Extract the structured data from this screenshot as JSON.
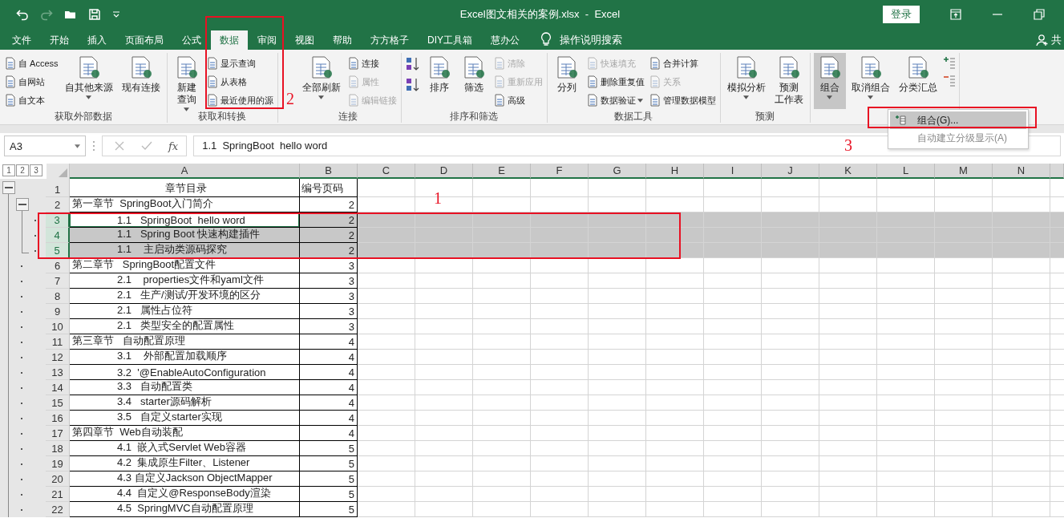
{
  "window": {
    "title": "Excel图文相关的案例.xlsx  -  Excel",
    "sign_in": "登录"
  },
  "tabs": [
    {
      "label": "文件",
      "selected": false
    },
    {
      "label": "开始",
      "selected": false
    },
    {
      "label": "插入",
      "selected": false
    },
    {
      "label": "页面布局",
      "selected": false
    },
    {
      "label": "公式",
      "selected": false
    },
    {
      "label": "数据",
      "selected": true
    },
    {
      "label": "审阅",
      "selected": false
    },
    {
      "label": "视图",
      "selected": false
    },
    {
      "label": "帮助",
      "selected": false
    },
    {
      "label": "方方格子",
      "selected": false
    },
    {
      "label": "DIY工具箱",
      "selected": false
    },
    {
      "label": "慧办公",
      "selected": false
    }
  ],
  "tell_me": {
    "label": "操作说明搜索"
  },
  "share": {
    "label": "共"
  },
  "ribbon": {
    "groups": [
      {
        "label": "获取外部数据",
        "items": [
          {
            "kind": "stack",
            "items": [
              {
                "label": "自 Access",
                "disabled": false,
                "dropdown": false
              },
              {
                "label": "自网站",
                "disabled": false,
                "dropdown": false
              },
              {
                "label": "自文本",
                "disabled": false,
                "dropdown": false
              }
            ]
          },
          {
            "kind": "large",
            "lines": [
              "自其他来源"
            ],
            "dropdown": true,
            "disabled": false,
            "pressed": false
          },
          {
            "kind": "large",
            "lines": [
              "现有连接"
            ],
            "dropdown": false,
            "disabled": false,
            "pressed": false
          }
        ]
      },
      {
        "label": "获取和转换",
        "items": [
          {
            "kind": "large",
            "lines": [
              "新建",
              "查询"
            ],
            "dropdown": true,
            "disabled": false,
            "pressed": false
          },
          {
            "kind": "stack",
            "items": [
              {
                "label": "显示查询",
                "disabled": false,
                "dropdown": false
              },
              {
                "label": "从表格",
                "disabled": false,
                "dropdown": false
              },
              {
                "label": "最近使用的源",
                "disabled": false,
                "dropdown": false
              }
            ]
          }
        ]
      },
      {
        "label": "连接",
        "items": [
          {
            "kind": "large",
            "lines": [
              "全部刷新"
            ],
            "dropdown": true,
            "disabled": false,
            "pressed": false
          },
          {
            "kind": "stack",
            "items": [
              {
                "label": "连接",
                "disabled": false,
                "dropdown": false
              },
              {
                "label": "属性",
                "disabled": true,
                "dropdown": false
              },
              {
                "label": "编辑链接",
                "disabled": true,
                "dropdown": false
              }
            ]
          }
        ]
      },
      {
        "label": "排序和筛选",
        "items": [
          {
            "kind": "sort_buttons"
          },
          {
            "kind": "large",
            "lines": [
              "排序"
            ],
            "dropdown": false,
            "disabled": false,
            "pressed": false
          },
          {
            "kind": "large",
            "lines": [
              "筛选"
            ],
            "dropdown": false,
            "disabled": false,
            "pressed": false
          },
          {
            "kind": "stack",
            "items": [
              {
                "label": "清除",
                "disabled": true,
                "dropdown": false
              },
              {
                "label": "重新应用",
                "disabled": true,
                "dropdown": false
              },
              {
                "label": "高级",
                "disabled": false,
                "dropdown": false
              }
            ]
          }
        ]
      },
      {
        "label": "数据工具",
        "items": [
          {
            "kind": "large",
            "lines": [
              "分列"
            ],
            "dropdown": false,
            "disabled": false,
            "pressed": false
          },
          {
            "kind": "stack",
            "items": [
              {
                "label": "快速填充",
                "disabled": true,
                "dropdown": false
              },
              {
                "label": "删除重复值",
                "disabled": false,
                "dropdown": false
              },
              {
                "label": "数据验证",
                "disabled": false,
                "dropdown": true
              }
            ]
          },
          {
            "kind": "stack",
            "items": [
              {
                "label": "合并计算",
                "disabled": false,
                "dropdown": false
              },
              {
                "label": "关系",
                "disabled": true,
                "dropdown": false
              },
              {
                "label": "管理数据模型",
                "disabled": false,
                "dropdown": false
              }
            ]
          }
        ]
      },
      {
        "label": "预测",
        "items": [
          {
            "kind": "large",
            "lines": [
              "模拟分析"
            ],
            "dropdown": true,
            "disabled": false,
            "pressed": false
          },
          {
            "kind": "large",
            "lines": [
              "预测",
              "工作表"
            ],
            "dropdown": false,
            "disabled": false,
            "pressed": false
          }
        ]
      },
      {
        "items": [
          {
            "kind": "large",
            "lines": [
              "组合"
            ],
            "dropdown": true,
            "disabled": false,
            "pressed": true
          },
          {
            "kind": "large",
            "lines": [
              "取消组合"
            ],
            "dropdown": true,
            "disabled": false,
            "pressed": false
          },
          {
            "kind": "large",
            "lines": [
              "分类汇总"
            ],
            "dropdown": false,
            "disabled": false,
            "pressed": false
          },
          {
            "kind": "detail_buttons"
          }
        ]
      }
    ]
  },
  "formula_bar": {
    "name_box": "A3",
    "function_label": "fx",
    "content": "1.1  SpringBoot  hello word"
  },
  "sheet": {
    "outline_levels": [
      "1",
      "2",
      "3"
    ],
    "columns": [
      "A",
      "B",
      "C",
      "D",
      "E",
      "F",
      "G",
      "H",
      "I",
      "J",
      "K",
      "L",
      "M",
      "N"
    ],
    "rows": [
      {
        "number": "1",
        "kind": "header",
        "a": "章节目录",
        "b": "编号页码",
        "selected": false,
        "active": false,
        "outline": {
          "kind": "top"
        }
      },
      {
        "number": "2",
        "kind": "chapter",
        "a": "第一章节  SpringBoot入门简介",
        "b": "2",
        "selected": false,
        "active": false,
        "outline": {
          "kind": "group"
        }
      },
      {
        "number": "3",
        "kind": "section",
        "a": "1.1   SpringBoot  hello word",
        "b": "2",
        "selected": true,
        "active": true,
        "outline": {
          "kind": "detail3"
        }
      },
      {
        "number": "4",
        "kind": "section",
        "a": "1.1   Spring Boot 快速构建插件",
        "b": "2",
        "selected": true,
        "active": false,
        "outline": {
          "kind": "detail3"
        }
      },
      {
        "number": "5",
        "kind": "section",
        "a": "1.1    主启动类源码探究",
        "b": "2",
        "selected": true,
        "active": false,
        "outline": {
          "kind": "detail3end"
        }
      },
      {
        "number": "6",
        "kind": "chapter",
        "a": "第二章节   SpringBoot配置文件",
        "b": "3",
        "selected": false,
        "active": false,
        "outline": {
          "kind": "detail2"
        }
      },
      {
        "number": "7",
        "kind": "section",
        "a": "2.1    properties文件和yaml文件",
        "b": "3",
        "selected": false,
        "active": false,
        "outline": {
          "kind": "detail2"
        }
      },
      {
        "number": "8",
        "kind": "section",
        "a": "2.1   生产/测试/开发环境的区分",
        "b": "3",
        "selected": false,
        "active": false,
        "outline": {
          "kind": "detail2"
        }
      },
      {
        "number": "9",
        "kind": "section",
        "a": "2.1   属性占位符",
        "b": "3",
        "selected": false,
        "active": false,
        "outline": {
          "kind": "detail2"
        }
      },
      {
        "number": "10",
        "kind": "section",
        "a": "2.1   类型安全的配置属性",
        "b": "3",
        "selected": false,
        "active": false,
        "outline": {
          "kind": "detail2"
        }
      },
      {
        "number": "11",
        "kind": "chapter",
        "a": "第三章节   自动配置原理",
        "b": "4",
        "selected": false,
        "active": false,
        "outline": {
          "kind": "detail2"
        }
      },
      {
        "number": "12",
        "kind": "section",
        "a": "3.1    外部配置加载顺序",
        "b": "4",
        "selected": false,
        "active": false,
        "outline": {
          "kind": "detail2"
        }
      },
      {
        "number": "13",
        "kind": "section",
        "a": "3.2  '@EnableAutoConfiguration",
        "b": "4",
        "selected": false,
        "active": false,
        "outline": {
          "kind": "detail2"
        }
      },
      {
        "number": "14",
        "kind": "section",
        "a": "3.3   自动配置类",
        "b": "4",
        "selected": false,
        "active": false,
        "outline": {
          "kind": "detail2"
        }
      },
      {
        "number": "15",
        "kind": "section",
        "a": "3.4   starter源码解析",
        "b": "4",
        "selected": false,
        "active": false,
        "outline": {
          "kind": "detail2"
        }
      },
      {
        "number": "16",
        "kind": "section",
        "a": "3.5   自定义starter实现",
        "b": "4",
        "selected": false,
        "active": false,
        "outline": {
          "kind": "detail2"
        }
      },
      {
        "number": "17",
        "kind": "chapter",
        "a": "第四章节  Web自动装配",
        "b": "4",
        "selected": false,
        "active": false,
        "outline": {
          "kind": "detail2"
        }
      },
      {
        "number": "18",
        "kind": "section",
        "a": "4.1  嵌入式Servlet Web容器",
        "b": "5",
        "selected": false,
        "active": false,
        "outline": {
          "kind": "detail2"
        }
      },
      {
        "number": "19",
        "kind": "section",
        "a": "4.2  集成原生Filter、Listener",
        "b": "5",
        "selected": false,
        "active": false,
        "outline": {
          "kind": "detail2"
        }
      },
      {
        "number": "20",
        "kind": "section",
        "a": "4.3 自定义Jackson ObjectMapper",
        "b": "5",
        "selected": false,
        "active": false,
        "outline": {
          "kind": "detail2"
        }
      },
      {
        "number": "21",
        "kind": "section",
        "a": "4.4  自定义@ResponseBody渲染",
        "b": "5",
        "selected": false,
        "active": false,
        "outline": {
          "kind": "detail2"
        }
      },
      {
        "number": "22",
        "kind": "section",
        "a": "4.5  SpringMVC自动配置原理",
        "b": "5",
        "selected": false,
        "active": false,
        "outline": {
          "kind": "detail2"
        }
      }
    ]
  },
  "group_menu": {
    "items": [
      {
        "label": "组合(G)...",
        "selected": true,
        "disabled": false
      },
      {
        "label": "自动建立分级显示(A)",
        "selected": false,
        "disabled": true
      }
    ]
  },
  "annotations": [
    {
      "label": "1"
    },
    {
      "label": "2"
    },
    {
      "label": "3"
    }
  ]
}
